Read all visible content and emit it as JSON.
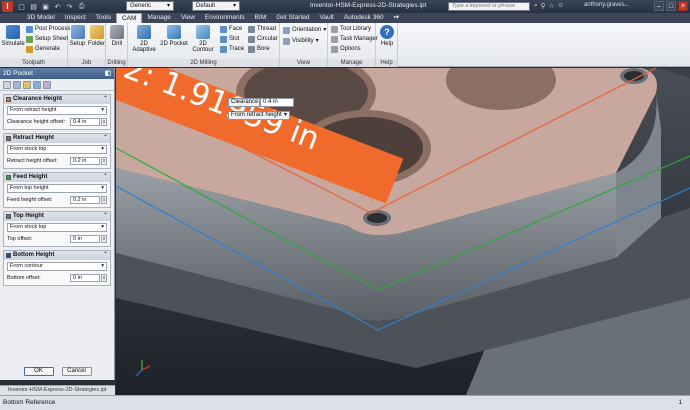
{
  "titlebar": {
    "app_badge": "I",
    "qat_icons": [
      "new-icon",
      "open-icon",
      "save-icon",
      "undo-icon",
      "redo-icon",
      "print-icon"
    ],
    "appearance_combo": "Generic",
    "style_combo": "Default",
    "title": "Inventor-HSM-Express-2D-Strategies.ipt",
    "search_placeholder": "Type a keyword or phrase",
    "user": "anthony.graves..."
  },
  "tabs": [
    "3D Model",
    "Inspect",
    "Tools",
    "CAM",
    "Manage",
    "View",
    "Environments",
    "BIM",
    "Get Started",
    "Vault",
    "Autodesk 360"
  ],
  "active_tab": "CAM",
  "ribbon": {
    "toolpath": {
      "label": "Toolpath",
      "simulate": "Simulate",
      "post_process": "Post Process",
      "setup_sheet": "Setup Sheet",
      "generate": "Generate"
    },
    "job": {
      "label": "Job",
      "setup": "Setup",
      "folder": "Folder"
    },
    "drilling": {
      "label": "Drilling",
      "drill": "Drill"
    },
    "milling_2d": {
      "label": "2D Milling",
      "adaptive": "2D Adaptive",
      "pocket": "2D Pocket",
      "contour": "2D Contour",
      "face": "Face",
      "slot": "Slot",
      "trace": "Trace",
      "thread": "Thread",
      "circular": "Circular",
      "bore": "Bore"
    },
    "view": {
      "label": "View",
      "orientation": "Orientation",
      "visibility": "Visibility"
    },
    "manage": {
      "label": "Manage",
      "tool_library": "Tool Library",
      "task_manager": "Task Manager",
      "options": "Options"
    },
    "help": {
      "label": "Help",
      "help": "Help"
    }
  },
  "panel": {
    "title": "2D Pocket",
    "sections": [
      {
        "title": "Clearance Height",
        "color": "#e07b2f",
        "select": "From retract height",
        "field_label": "Clearance height offset:",
        "value": "0.4 in"
      },
      {
        "title": "Retract Height",
        "color": "#8a6c3a",
        "select": "From stock top",
        "field_label": "Retract height offset:",
        "value": "0.2 in"
      },
      {
        "title": "Feed Height",
        "color": "#2fa83a",
        "select": "From top height",
        "field_label": "Feed height offset:",
        "value": "0.2 in"
      },
      {
        "title": "Top Height",
        "color": "#2f7fd8",
        "select": "From stock top",
        "field_label": "Top offset:",
        "value": "0 in"
      },
      {
        "title": "Bottom Height",
        "color": "#1f3fb0",
        "select": "From contour",
        "field_label": "Bottom offset:",
        "value": "0 in"
      }
    ],
    "ok": "OK",
    "cancel": "Cancel"
  },
  "browser_item": "Inventor-HSM-Express-2D-Strategies.ipt",
  "viewport": {
    "dimension_label": "1.91959 in",
    "dimension_prefix": "2:",
    "clearance_label": "Clearance",
    "clearance_value": "0.4 in",
    "retract_select": "From retract height"
  },
  "status": {
    "left": "Bottom Reference",
    "right": "1"
  }
}
